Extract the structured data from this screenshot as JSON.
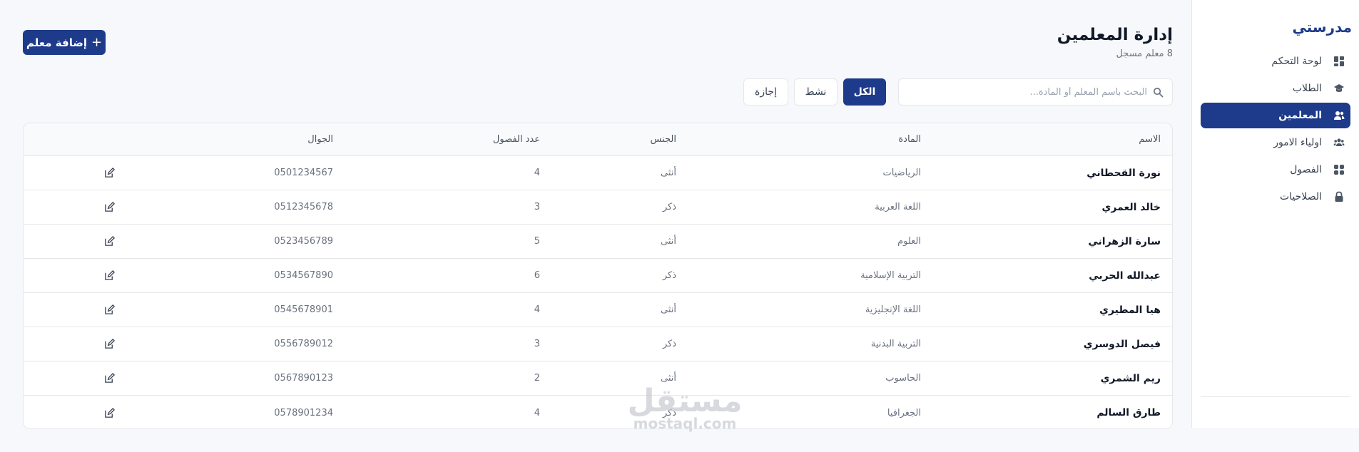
{
  "brand": {
    "name": "مدرستي"
  },
  "sidebar": {
    "items": [
      {
        "label": "لوحة التحكم",
        "icon": "dashboard-icon",
        "active": false
      },
      {
        "label": "الطلاب",
        "icon": "graduation-cap-icon",
        "active": false
      },
      {
        "label": "المعلمين",
        "icon": "users-icon",
        "active": true
      },
      {
        "label": "اولياء الامور",
        "icon": "parents-icon",
        "active": false
      },
      {
        "label": "الفصول",
        "icon": "grid-icon",
        "active": false
      },
      {
        "label": "الصلاحيات",
        "icon": "lock-icon",
        "active": false
      }
    ]
  },
  "page": {
    "title": "إدارة المعلمين",
    "subtitle": "8 معلم مسجل",
    "add_button": "إضافة معلم"
  },
  "search": {
    "placeholder": "البحث باسم المعلم أو المادة...",
    "value": ""
  },
  "filters": [
    {
      "label": "الكل",
      "active": true
    },
    {
      "label": "نشط",
      "active": false
    },
    {
      "label": "إجازة",
      "active": false
    }
  ],
  "table": {
    "headers": {
      "name": "الاسم",
      "subject": "المادة",
      "gender": "الجنس",
      "classes": "عدد الفصول",
      "phone": "الجوال"
    },
    "rows": [
      {
        "name": "نورة القحطاني",
        "subject": "الرياضيات",
        "gender": "أنثى",
        "classes": "4",
        "phone": "0501234567"
      },
      {
        "name": "خالد العمري",
        "subject": "اللغة العربية",
        "gender": "ذكر",
        "classes": "3",
        "phone": "0512345678"
      },
      {
        "name": "سارة الزهراني",
        "subject": "العلوم",
        "gender": "أنثى",
        "classes": "5",
        "phone": "0523456789"
      },
      {
        "name": "عبدالله الحربي",
        "subject": "التربية الإسلامية",
        "gender": "ذكر",
        "classes": "6",
        "phone": "0534567890"
      },
      {
        "name": "هيا المطيري",
        "subject": "اللغة الإنجليزية",
        "gender": "أنثى",
        "classes": "4",
        "phone": "0545678901"
      },
      {
        "name": "فيصل الدوسري",
        "subject": "التربية البدنية",
        "gender": "ذكر",
        "classes": "3",
        "phone": "0556789012"
      },
      {
        "name": "ريم الشمري",
        "subject": "الحاسوب",
        "gender": "أنثى",
        "classes": "2",
        "phone": "0567890123"
      },
      {
        "name": "طارق السالم",
        "subject": "الجغرافيا",
        "gender": "ذكر",
        "classes": "4",
        "phone": "0578901234"
      }
    ]
  },
  "watermark": {
    "arabic": "مستقل",
    "latin": "mostaql.com"
  },
  "colors": {
    "primary": "#1e3a8a",
    "background": "#f7f8fb"
  }
}
